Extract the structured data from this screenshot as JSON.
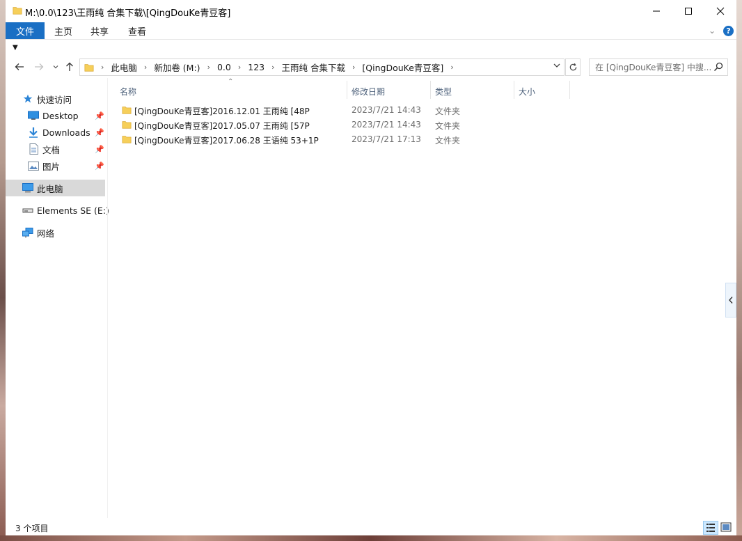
{
  "window": {
    "title": "M:\\0.0\\123\\王雨纯 合集下载\\[QingDouKe青豆客]"
  },
  "ribbon": {
    "tabs": [
      "文件",
      "主页",
      "共享",
      "查看"
    ]
  },
  "address": {
    "crumbs": [
      "此电脑",
      "新加卷 (M:)",
      "0.0",
      "123",
      "王雨纯 合集下载",
      "[QingDouKe青豆客]"
    ]
  },
  "search": {
    "placeholder": "在 [QingDouKe青豆客] 中搜..."
  },
  "navpane": {
    "quick_access": "快速访问",
    "items": [
      {
        "label": "Desktop",
        "icon": "desktop-icon",
        "pinned": true
      },
      {
        "label": "Downloads",
        "icon": "downloads-icon",
        "pinned": true
      },
      {
        "label": "文档",
        "icon": "documents-icon",
        "pinned": true
      },
      {
        "label": "图片",
        "icon": "pictures-icon",
        "pinned": true
      }
    ],
    "this_pc": "此电脑",
    "drive": "Elements SE (E:)",
    "network": "网络"
  },
  "columns": {
    "name": "名称",
    "date": "修改日期",
    "type": "类型",
    "size": "大小"
  },
  "files": [
    {
      "name": "[QingDouKe青豆客]2016.12.01 王雨纯 [48P",
      "date": "2023/7/21 14:43",
      "type": "文件夹"
    },
    {
      "name": "[QingDouKe青豆客]2017.05.07 王雨纯 [57P",
      "date": "2023/7/21 14:43",
      "type": "文件夹"
    },
    {
      "name": "[QingDouKe青豆客]2017.06.28 王语纯 53+1P",
      "date": "2023/7/21 17:13",
      "type": "文件夹"
    }
  ],
  "status": {
    "count": "3 个项目"
  },
  "colors": {
    "accent": "#1a6fc4",
    "folder": "#f6cf5a",
    "selected_nav": "#d9d9d9"
  }
}
